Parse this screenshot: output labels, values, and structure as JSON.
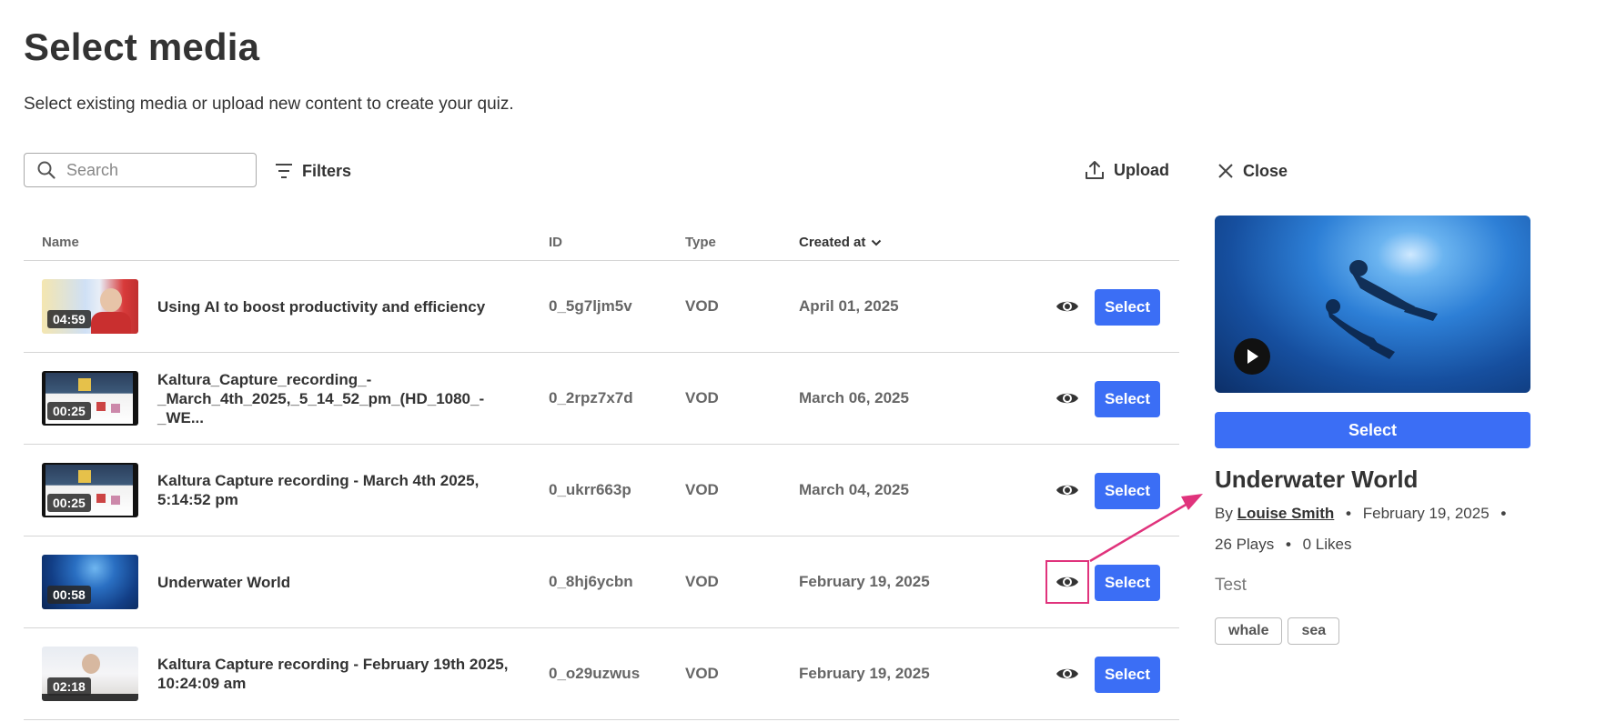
{
  "header": {
    "title": "Select media",
    "subtitle": "Select existing media or upload new content to create your quiz."
  },
  "toolbar": {
    "search_placeholder": "Search",
    "filters_label": "Filters",
    "upload_label": "Upload",
    "close_label": "Close"
  },
  "table": {
    "columns": {
      "name": "Name",
      "id": "ID",
      "type": "Type",
      "created": "Created at"
    },
    "select_label": "Select",
    "rows": [
      {
        "duration": "04:59",
        "name": "Using AI to boost productivity and efficiency",
        "id": "0_5g7ljm5v",
        "type": "VOD",
        "date": "April 01, 2025"
      },
      {
        "duration": "00:25",
        "name_line1": "Kaltura_Capture_recording_-",
        "name_line2": "_March_4th_2025,_5_14_52_pm_(HD_1080_-_WE...",
        "id": "0_2rpz7x7d",
        "type": "VOD",
        "date": "March 06, 2025"
      },
      {
        "duration": "00:25",
        "name_line1": "Kaltura Capture recording - March 4th 2025,",
        "name_line2": "5:14:52 pm",
        "id": "0_ukrr663p",
        "type": "VOD",
        "date": "March 04, 2025"
      },
      {
        "duration": "00:58",
        "name": "Underwater World",
        "id": "0_8hj6ycbn",
        "type": "VOD",
        "date": "February 19, 2025"
      },
      {
        "duration": "02:18",
        "name_line1": "Kaltura Capture recording - February 19th 2025,",
        "name_line2": "10:24:09 am",
        "id": "0_o29uzwus",
        "type": "VOD",
        "date": "February 19, 2025"
      }
    ]
  },
  "detail_panel": {
    "select_label": "Select",
    "title": "Underwater World",
    "by_label": "By",
    "author": "Louise Smith",
    "date": "February 19, 2025",
    "plays": "26 Plays",
    "likes": "0 Likes",
    "description": "Test",
    "tags": [
      "whale",
      "sea"
    ]
  },
  "colors": {
    "accent": "#3b6ef5",
    "highlight": "#e0337c"
  },
  "icons": [
    "search-icon",
    "filter-icon",
    "upload-icon",
    "close-icon",
    "chevron-down-icon",
    "eye-icon",
    "play-icon"
  ]
}
